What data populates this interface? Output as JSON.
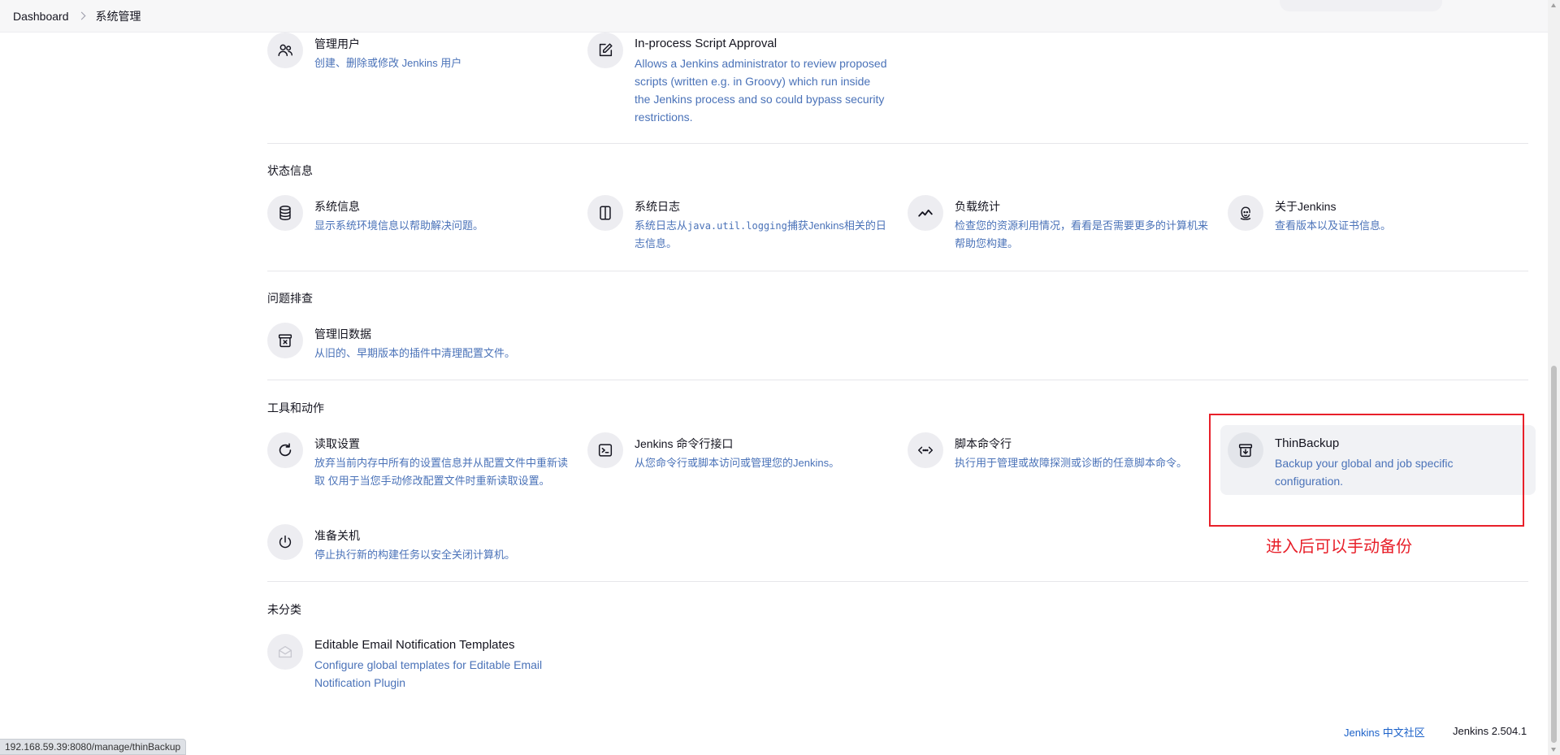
{
  "breadcrumb": {
    "home": "Dashboard",
    "current": "系统管理"
  },
  "sections": {
    "status": "状态信息",
    "troubleshooting": "问题排查",
    "tools": "工具和动作",
    "uncategorized": "未分类"
  },
  "items": {
    "manage_users": {
      "title": "管理用户",
      "desc": "创建、删除或修改 Jenkins 用户",
      "icon": "users-icon"
    },
    "script_approval": {
      "title": "In-process Script Approval",
      "desc": "Allows a Jenkins administrator to review proposed scripts (written e.g. in Groovy) which run inside the Jenkins process and so could bypass security restrictions.",
      "icon": "edit-icon"
    },
    "system_info": {
      "title": "系统信息",
      "desc": "显示系统环境信息以帮助解决问题。",
      "icon": "database-icon"
    },
    "system_log": {
      "title": "系统日志",
      "desc_pre": "系统日志从",
      "desc_code": "java.util.logging",
      "desc_post": "捕获Jenkins相关的日志信息。",
      "icon": "log-icon"
    },
    "load_stats": {
      "title": "负载统计",
      "desc": "检查您的资源利用情况，看看是否需要更多的计算机来帮助您构建。",
      "icon": "trend-icon"
    },
    "about": {
      "title": "关于Jenkins",
      "desc": "查看版本以及证书信息。",
      "icon": "jenkins-icon"
    },
    "old_data": {
      "title": "管理旧数据",
      "desc": "从旧的、早期版本的插件中清理配置文件。",
      "icon": "archive-x-icon"
    },
    "reload": {
      "title": "读取设置",
      "desc": "放弃当前内存中所有的设置信息并从配置文件中重新读取 仅用于当您手动修改配置文件时重新读取设置。",
      "icon": "reload-icon"
    },
    "cli": {
      "title": "Jenkins 命令行接口",
      "desc": "从您命令行或脚本访问或管理您的Jenkins。",
      "icon": "terminal-icon"
    },
    "script_console": {
      "title": "脚本命令行",
      "desc": "执行用于管理或故障探测或诊断的任意脚本命令。",
      "icon": "code-icon"
    },
    "thinbackup": {
      "title": "ThinBackup",
      "desc": "Backup your global and job specific configuration.",
      "icon": "archive-download-icon"
    },
    "shutdown": {
      "title": "准备关机",
      "desc": "停止执行新的构建任务以安全关闭计算机。",
      "icon": "power-icon"
    },
    "email_templates": {
      "title": "Editable Email Notification Templates",
      "desc": "Configure global templates for Editable Email Notification Plugin",
      "icon": "email-icon"
    }
  },
  "annotation": "进入后可以手动备份",
  "footer": {
    "community": "Jenkins 中文社区",
    "version": "Jenkins 2.504.1"
  },
  "status_url": "192.168.59.39:8080/manage/thinBackup",
  "colors": {
    "link": "#4a72b8",
    "annotation": "#e8202a",
    "footer_link": "#1c62c9"
  }
}
